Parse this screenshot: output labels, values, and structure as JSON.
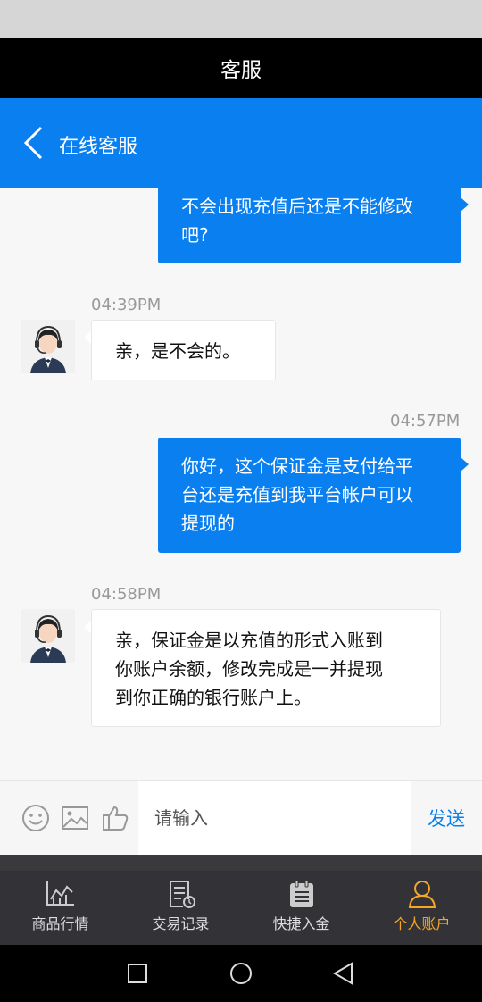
{
  "app": {
    "title": "客服"
  },
  "chat": {
    "title": "在线客服"
  },
  "messages": [
    {
      "direction": "outgoing",
      "time": "",
      "text_lines": [
        "不会出现充值后还是不能修改",
        "吧?"
      ]
    },
    {
      "direction": "incoming",
      "time": "04:39PM",
      "text_lines": [
        "亲，是不会的。"
      ]
    },
    {
      "direction": "outgoing",
      "time": "04:57PM",
      "text_lines": [
        "你好，这个保证金是支付给平",
        "台还是充值到我平台帐户可以",
        "提现的"
      ]
    },
    {
      "direction": "incoming",
      "time": "04:58PM",
      "text_lines": [
        "亲，保证金是以充值的形式入账到",
        "你账户余额，修改完成是一并提现",
        "到你正确的银行账户上。"
      ]
    }
  ],
  "input": {
    "placeholder": "请输入",
    "value": "",
    "send_label": "发送"
  },
  "tabs": [
    {
      "label": "商品行情",
      "icon": "chart-icon",
      "active": false
    },
    {
      "label": "交易记录",
      "icon": "records-icon",
      "active": false
    },
    {
      "label": "快捷入金",
      "icon": "clipboard-icon",
      "active": false
    },
    {
      "label": "个人账户",
      "icon": "user-icon",
      "active": true
    }
  ],
  "colors": {
    "primary": "#0a7ff0",
    "active_tab": "#f5a623",
    "tab_bar_bg": "#333337"
  },
  "system_nav": [
    "square-icon",
    "circle-icon",
    "triangle-back-icon"
  ]
}
